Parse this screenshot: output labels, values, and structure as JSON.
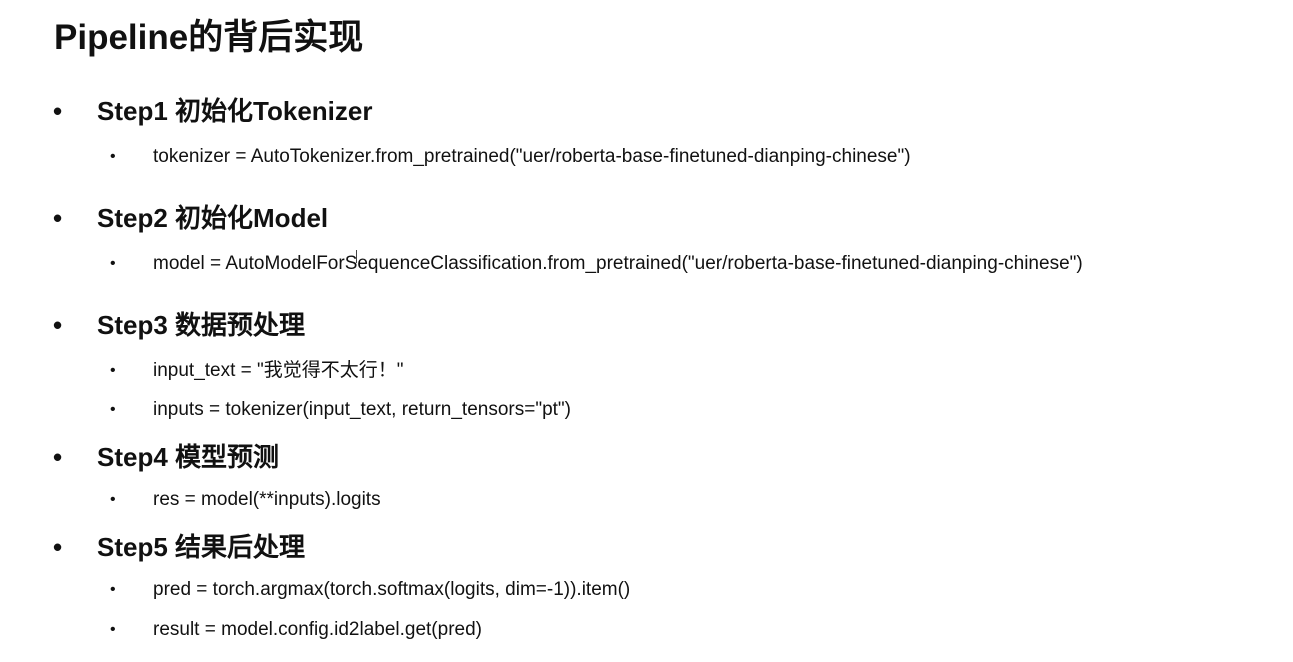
{
  "title": "Pipeline的背后实现",
  "bullet_major": "•",
  "bullet_minor": "•",
  "steps": [
    {
      "label": "Step1 初始化Tokenizer",
      "items": [
        "tokenizer = AutoTokenizer.from_pretrained(\"uer/roberta-base-finetuned-dianping-chinese\")"
      ]
    },
    {
      "label": "Step2 初始化Model",
      "items": [
        "model = AutoModelForSequenceClassification.from_pretrained(\"uer/roberta-base-finetuned-dianping-chinese\")"
      ]
    },
    {
      "label": "Step3 数据预处理",
      "items": [
        "input_text = \"我觉得不太行！\"",
        "inputs = tokenizer(input_text, return_tensors=\"pt\")"
      ]
    },
    {
      "label": "Step4 模型预测",
      "items": [
        "res = model(**inputs).logits"
      ]
    },
    {
      "label": "Step5 结果后处理",
      "items": [
        "pred = torch.argmax(torch.softmax(logits, dim=-1)).item()",
        "result = model.config.id2label.get(pred)"
      ]
    }
  ]
}
